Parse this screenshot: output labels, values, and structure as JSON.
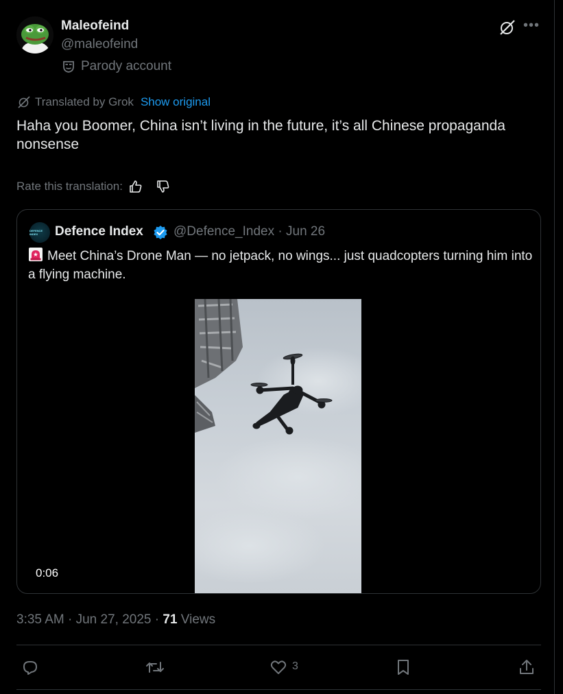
{
  "author": {
    "name": "Maleofeind",
    "handle": "@maleofeind",
    "badge": "Parody account"
  },
  "translation": {
    "prefix": "Translated by Grok",
    "show_original": "Show original",
    "text": "Haha you Boomer, China isn’t living in the future, it’s all Chinese propaganda nonsense",
    "rate_label": "Rate this translation:"
  },
  "quote": {
    "name": "Defence Index",
    "handle": "@Defence_Index",
    "separator": "·",
    "date": "Jun 26",
    "avatar_text": "DEFENCE INDEX",
    "text": "Meet China’s Drone Man — no jetpack, no wings... just quadcopters turning him into a flying machine.",
    "video_duration": "0:06"
  },
  "meta": {
    "time": "3:35 AM",
    "dot": "·",
    "date": "Jun 27, 2025",
    "dot2": "·",
    "views_count": "71",
    "views_label": "Views"
  },
  "actions": {
    "likes": "3"
  },
  "colors": {
    "background": "#000000",
    "text": "#e7e9ea",
    "muted": "#71767b",
    "link": "#1d9bf0",
    "border": "#2f3336",
    "verified": "#1d9bf0"
  },
  "icons": [
    "grok-icon",
    "more-icon",
    "mask-icon",
    "thumbs-up-icon",
    "thumbs-down-icon",
    "verified-icon",
    "siren-icon",
    "reply-icon",
    "repost-icon",
    "like-icon",
    "bookmark-icon",
    "share-icon"
  ]
}
